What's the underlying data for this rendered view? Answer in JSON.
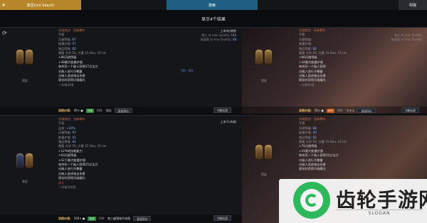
{
  "topbar": {
    "live_plus": "+",
    "live_label": "激活Live Search",
    "search_label": "搜索",
    "clear_label": "明确"
  },
  "results_header": "显示4个结果",
  "cards": [
    {
      "name": "祝福挑战 · 亚麻裹布",
      "type": "手套",
      "verify": "验证",
      "time": "上市4分钟前",
      "qual_lines": [
        {
          "label": "耐久 at max Quality:",
          "value": "104"
        },
        {
          "label": "能量盾 at max Quality:",
          "value": "68"
        }
      ],
      "lines": [
        {
          "text": "闪避等级: ",
          "val": "87",
          "cls": "prop"
        },
        {
          "text": "能量护盾: ",
          "val": "57",
          "cls": "prop"
        },
        {
          "text": "物品等级: ",
          "val": "82",
          "cls": "prop"
        },
        {
          "text": "需要 大学 56, 力量 15 Dex, 15 Int",
          "cls": "prop"
        },
        {
          "text": "+86闪避等级",
          "cls": "mod"
        },
        {
          "text": "+48最大能量护盾",
          "cls": "mod"
        },
        {
          "text": "每杀死一个敌人获得27点法力",
          "cls": "mod"
        },
        {
          "text": "对敌人进行冷暴露",
          "cls": "mod"
        },
        {
          "text": "对敌人造成电击伤害",
          "cls": "mod"
        },
        {
          "text": "腐化时获得闪电耀光",
          "cls": "mod"
        },
        {
          "text": "一价格49条",
          "cls": "muted"
        }
      ],
      "range": "[30—30]",
      "footer": {
        "price_label": "该换价格:",
        "price": "49× ●",
        "badge": "在线",
        "ign": "IGN:",
        "account": "他达",
        "button": "直接拜访"
      },
      "whisper": "邻聊玩家"
    },
    {
      "name": "祝福挑战 · 亚麻裹布",
      "type": "手套",
      "verify": "验证",
      "qual_lines": [
        {
          "label": "耐久 at max Quality:",
          "value": ""
        },
        {
          "label": "能量盾 at max Quality:",
          "value": ""
        }
      ],
      "lines": [
        {
          "text": "闪避等级: ",
          "val": "",
          "cls": "prop"
        },
        {
          "text": "能量护盾: ",
          "val": "",
          "cls": "prop"
        },
        {
          "text": "物品等级: ",
          "val": "82",
          "cls": "prop"
        },
        {
          "text": "需要 大学 56, 力量 15 Dex, 15 Int",
          "cls": "prop"
        },
        {
          "text": "+86闪避等级",
          "cls": "mod"
        },
        {
          "text": "+34最大能量护盾",
          "cls": "mod"
        },
        {
          "text": "每杀死一个敌人获得",
          "cls": "mod"
        },
        {
          "text": "对敌人进行冷暴露",
          "cls": "mod"
        },
        {
          "text": "对敌人造成电击伤害",
          "cls": "mod"
        },
        {
          "text": "腐化时获得闪电耀光",
          "cls": "mod"
        },
        {
          "text": "一价格50条",
          "cls": "muted"
        }
      ],
      "footer": {
        "price_label": "该换价格:",
        "price": "50× ●",
        "badge": "AFK",
        "ign": "IGN:",
        "account": "小小土",
        "button": "直接拜访"
      },
      "whisper": "邻聊玩家"
    },
    {
      "name": "祝福挑战 · 亚麻裹布",
      "type": "手套",
      "verify": "验证",
      "time": "上市7小时前",
      "lines": [
        {
          "text": "品质: ",
          "val": "+20%",
          "cls": "prop"
        },
        {
          "text": "闪避等级: ",
          "val": "97",
          "cls": "prop"
        },
        {
          "text": "能量护盾: ",
          "val": "61",
          "cls": "prop"
        },
        {
          "text": "物品等级: ",
          "val": "82",
          "cls": "prop"
        },
        {
          "text": "需要 大学 56, 力量 15 Dex, 15 Int",
          "cls": "prop"
        },
        {
          "text": "+12%的技能能力",
          "cls": "mod"
        },
        {
          "text": "+63闪避等级",
          "cls": "mod"
        },
        {
          "text": "+42下最大能量护盾",
          "cls": "mod"
        },
        {
          "text": "每杀死一个敌人获得25点法力",
          "cls": "mod"
        },
        {
          "text": "对敌人进行冷暴露",
          "cls": "mod"
        },
        {
          "text": "对敌人造成电击伤害",
          "cls": "mod"
        },
        {
          "text": "腐化时获得闪电耀光",
          "cls": "mod"
        },
        {
          "text": "腐化",
          "cls": "red"
        },
        {
          "text": "一价格100条",
          "cls": "muted"
        }
      ],
      "footer": {
        "price_label": "该换价格:",
        "price": "100× ●",
        "badge": "在线",
        "ign": "IGN:",
        "account": "商三越观帕代末图",
        "button": "直接拜访"
      },
      "whisper": "邻聊玩家"
    },
    {
      "name": "祝福挑战 · 亚麻裹布",
      "type": "手套",
      "verify": "验证",
      "lines": [
        {
          "text": "闪避等级: ",
          "val": "88",
          "cls": "prop"
        },
        {
          "text": "能量护盾: ",
          "val": "50",
          "cls": "prop"
        },
        {
          "text": "物品等级: ",
          "val": "82",
          "cls": "prop"
        },
        {
          "text": "需要 大学 56, 力量 15 Dex, 15 Int",
          "cls": "prop"
        },
        {
          "text": "+70闪避等级",
          "cls": "mod"
        },
        {
          "text": "+41最大能量护盾",
          "cls": "mod"
        },
        {
          "text": "每杀死一个敌人获得26点法力",
          "cls": "mod"
        },
        {
          "text": "对敌人进行冷暴露",
          "cls": "mod"
        },
        {
          "text": "对敌人造成电击伤害",
          "cls": "mod"
        },
        {
          "text": "腐化时获得闪电耀光",
          "cls": "mod"
        }
      ],
      "footer": {
        "price_label": "该换价格:",
        "price": "",
        "badge": "",
        "ign": "",
        "account": "",
        "button": ""
      },
      "whisper": ""
    }
  ],
  "watermark": {
    "title": "齿轮手游网",
    "slogan": "SLOGAN"
  },
  "colors": {
    "accent_gold": "#b8862a",
    "search_blue": "#1f5f82",
    "online_green": "#2d8a3a",
    "afk_orange": "#c45a1a",
    "item_name": "#b86a4a",
    "stat_blue": "#8bb3ff"
  }
}
